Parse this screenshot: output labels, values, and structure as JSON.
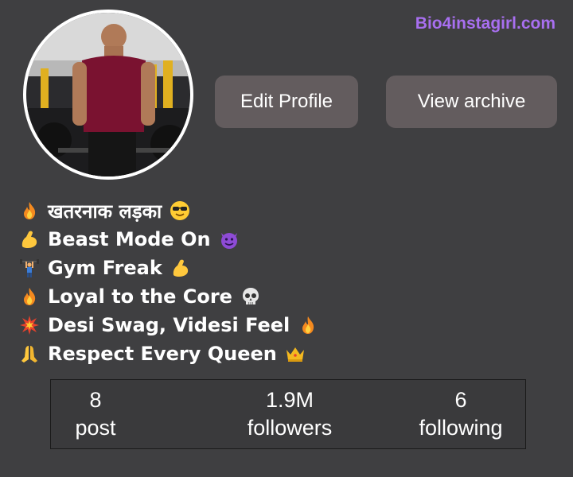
{
  "watermark": "Bio4instagirl.com",
  "profile": {
    "buttons": {
      "edit": "Edit Profile",
      "archive": "View archive"
    },
    "bio": [
      {
        "lead_icon": "fire-icon",
        "text": "खतरनाक लड़का",
        "trail_icon": "smiling-sunglasses-icon"
      },
      {
        "lead_icon": "flexed-biceps-icon",
        "text": "Beast Mode On",
        "trail_icon": "smiling-devil-icon"
      },
      {
        "lead_icon": "weightlifter-icon",
        "text": "Gym Freak",
        "trail_icon": "flexed-biceps-icon"
      },
      {
        "lead_icon": "fire-icon",
        "text": "Loyal to the Core",
        "trail_icon": "skull-icon"
      },
      {
        "lead_icon": "collision-icon",
        "text": "Desi Swag, Videsi Feel",
        "trail_icon": "fire-icon"
      },
      {
        "lead_icon": "folded-hands-icon",
        "text": "Respect Every Queen",
        "trail_icon": "crown-icon"
      }
    ],
    "stats": {
      "posts": {
        "value": "8",
        "label": "post"
      },
      "followers": {
        "value": "1.9M",
        "label": "followers"
      },
      "following": {
        "value": "6",
        "label": "following"
      }
    }
  },
  "colors": {
    "background": "#3f3f41",
    "button": "#635c5e",
    "watermark": "#a86ff0"
  }
}
